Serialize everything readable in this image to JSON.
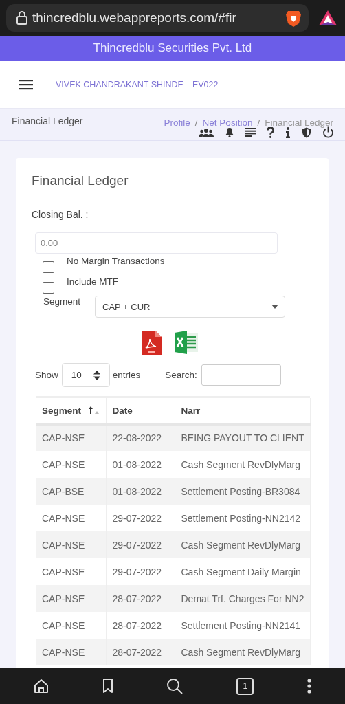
{
  "browser": {
    "url": "thincredblu.webappreports.com/#fir",
    "tab_count": "1"
  },
  "banner": {
    "title": "Thincredblu Securities Pvt. Ltd"
  },
  "header": {
    "user": "VIVEK CHANDRAKANT SHINDE",
    "code": "EV022"
  },
  "page_header": {
    "title": "Financial Ledger",
    "breadcrumb": [
      {
        "kind": "link",
        "text": "Profile"
      },
      {
        "kind": "separator",
        "text": "/"
      },
      {
        "kind": "link",
        "text": "Net Position"
      },
      {
        "kind": "separator",
        "text": "/"
      },
      {
        "kind": "current",
        "text": "Financial Ledger"
      }
    ]
  },
  "card": {
    "title": "Financial Ledger",
    "closing_label": "Closing Bal. :",
    "closing_value": "0.00",
    "checkboxes": [
      {
        "label": "No Margin Transactions",
        "checked": false
      },
      {
        "label": "Include MTF",
        "checked": false
      }
    ],
    "segment": {
      "label": "Segment",
      "value": "CAP + CUR"
    },
    "show": {
      "label": "Show",
      "value": "10",
      "suffix": "entries"
    },
    "search": {
      "label": "Search:"
    },
    "table": {
      "columns": [
        {
          "label": "Segment",
          "sorted": true
        },
        {
          "label": "Date",
          "sorted": false
        },
        {
          "label": "Narr",
          "sorted": false
        }
      ],
      "rows": [
        [
          "CAP-NSE",
          "22-08-2022",
          "BEING PAYOUT TO CLIENT"
        ],
        [
          "CAP-NSE",
          "01-08-2022",
          "Cash Segment RevDlyMarg"
        ],
        [
          "CAP-BSE",
          "01-08-2022",
          "Settlement Posting-BR3084"
        ],
        [
          "CAP-NSE",
          "29-07-2022",
          "Settlement Posting-NN2142"
        ],
        [
          "CAP-NSE",
          "29-07-2022",
          "Cash Segment RevDlyMarg"
        ],
        [
          "CAP-NSE",
          "29-07-2022",
          "Cash Segment Daily Margin"
        ],
        [
          "CAP-NSE",
          "28-07-2022",
          "Demat Trf. Charges For NN2"
        ],
        [
          "CAP-NSE",
          "28-07-2022",
          "Settlement Posting-NN2141"
        ],
        [
          "CAP-NSE",
          "28-07-2022",
          "Cash Segment RevDlyMarg"
        ]
      ]
    }
  }
}
